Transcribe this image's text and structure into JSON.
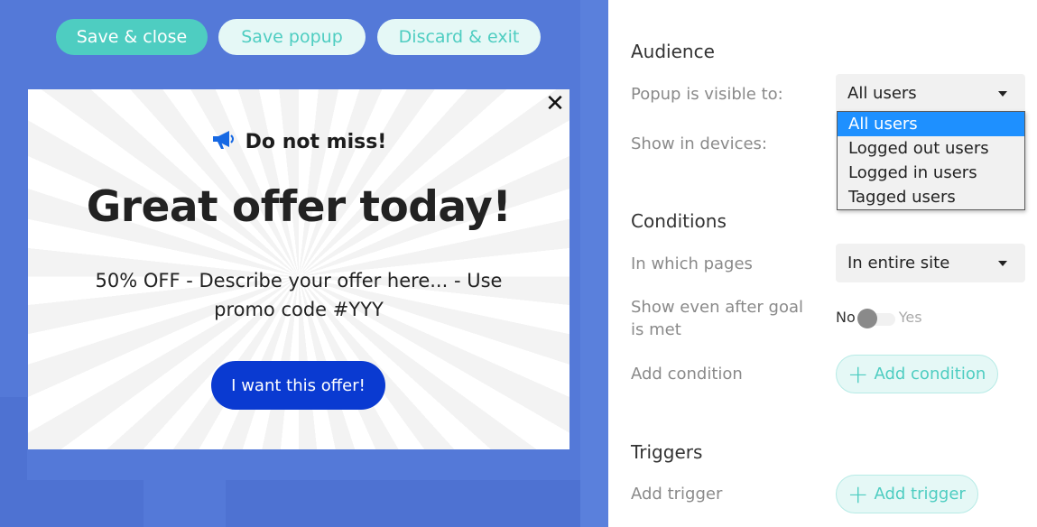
{
  "toolbar": {
    "save_close_label": "Save & close",
    "save_popup_label": "Save popup",
    "discard_exit_label": "Discard & exit"
  },
  "popup": {
    "close_symbol": "✕",
    "eyebrow_icon": "megaphone-icon",
    "eyebrow": "Do not miss!",
    "title": "Great offer today!",
    "description": "50% OFF - Describe your offer here... - Use promo code #YYY",
    "cta_label": "I want this offer!"
  },
  "audience": {
    "title": "Audience",
    "visible_label": "Popup is visible to:",
    "visible_selected": "All users",
    "visible_options": [
      "All users",
      "Logged out users",
      "Logged in users",
      "Tagged users"
    ],
    "devices_label": "Show in devices:"
  },
  "conditions": {
    "title": "Conditions",
    "pages_label": "In which pages",
    "pages_selected": "In entire site",
    "goal_label": "Show even after goal is met",
    "toggle_no": "No",
    "toggle_yes": "Yes",
    "toggle_value": false,
    "add_label": "Add condition",
    "add_button": "Add condition"
  },
  "triggers": {
    "title": "Triggers",
    "add_label": "Add trigger",
    "add_button": "Add trigger"
  },
  "colors": {
    "canvas_bg": "#5479d8",
    "accent_teal": "#4ecdc1",
    "cta_blue": "#0a3ad1",
    "selected_option": "#1e90ff"
  }
}
